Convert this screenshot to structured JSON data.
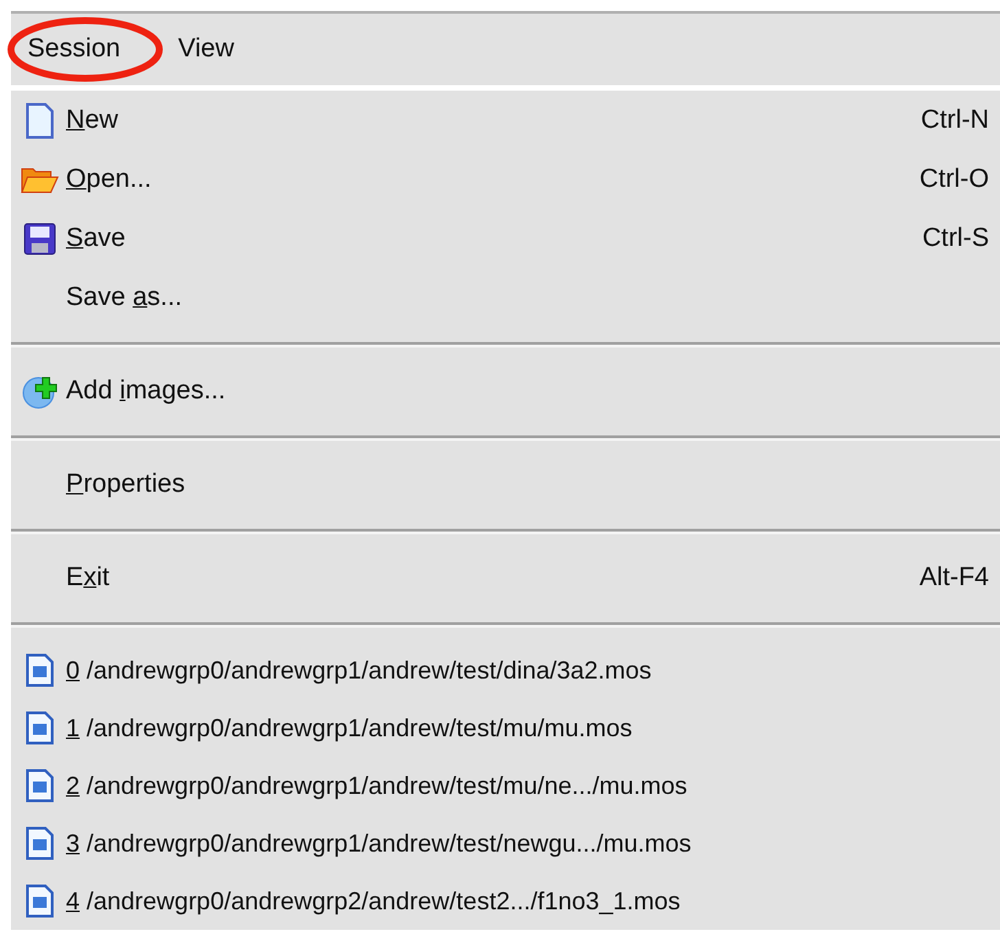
{
  "menubar": [
    {
      "label": "Session",
      "circled": true
    },
    {
      "label": "View",
      "circled": false
    }
  ],
  "sections": [
    {
      "items": [
        {
          "kind": "document",
          "key": "N",
          "after": "ew",
          "shortcut": "Ctrl-N"
        },
        {
          "kind": "folder",
          "key": "O",
          "after": "pen...",
          "shortcut": "Ctrl-O"
        },
        {
          "kind": "floppy",
          "key": "S",
          "after": "ave",
          "shortcut": "Ctrl-S"
        },
        {
          "kind": "plain",
          "before": "Save ",
          "key": "a",
          "after": "s..."
        }
      ]
    },
    {
      "items": [
        {
          "kind": "add",
          "before": "Add ",
          "key": "i",
          "after": "mages..."
        }
      ]
    },
    {
      "items": [
        {
          "kind": "plain",
          "key": "P",
          "after": "roperties"
        }
      ]
    },
    {
      "items": [
        {
          "kind": "plain",
          "before": "E",
          "key": "x",
          "after": "it",
          "shortcut": "Alt-F4"
        }
      ]
    },
    {
      "items": [
        {
          "kind": "recent",
          "key": "0",
          "after": " /andrewgrp0/andrewgrp1/andrew/test/dina/3a2.mos"
        },
        {
          "kind": "recent",
          "key": "1",
          "after": " /andrewgrp0/andrewgrp1/andrew/test/mu/mu.mos"
        },
        {
          "kind": "recent",
          "key": "2",
          "after": " /andrewgrp0/andrewgrp1/andrew/test/mu/ne.../mu.mos"
        },
        {
          "kind": "recent",
          "key": "3",
          "after": " /andrewgrp0/andrewgrp1/andrew/test/newgu.../mu.mos"
        },
        {
          "kind": "recent",
          "key": "4",
          "after": " /andrewgrp0/andrewgrp2/andrew/test2.../f1no3_1.mos"
        }
      ]
    }
  ]
}
